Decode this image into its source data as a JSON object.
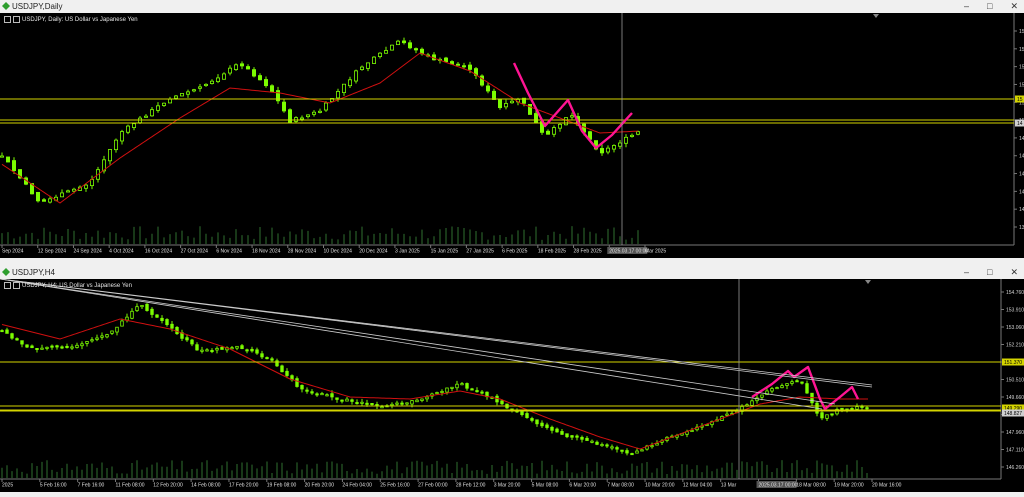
{
  "top": {
    "window_title": "USDJPY,Daily",
    "chart_label": "USDJPY, Daily: US Dollar vs Japanese Yen",
    "x_labels": [
      "Sep 2024",
      "12 Sep 2024",
      "24 Sep 2024",
      "4 Oct 2024",
      "16 Oct 2024",
      "27 Oct 2024",
      "6 Nov 2024",
      "18 Nov 2024",
      "28 Nov 2024",
      "10 Dec 2024",
      "20 Dec 2024",
      "3 Jan 2025",
      "15 Jan 2025",
      "27 Jan 2025",
      "6 Feb 2025",
      "18 Feb 2025",
      "28 Feb 2025",
      "2025.03.17 00:00",
      "Mar 2025"
    ],
    "y_labels": [
      "15",
      "15",
      "15",
      "15",
      "15",
      "15",
      "14",
      "14",
      "14",
      "14",
      "14",
      "13"
    ],
    "price_tag": "15",
    "price_tag2": "14"
  },
  "bottom": {
    "window_title": "USDJPY,H4",
    "chart_label": "USDJPY, H4: US Dollar vs Japanese Yen",
    "x_labels": [
      "2025",
      "5 Feb 16:00",
      "7 Feb 16:00",
      "11 Feb 08:00",
      "12 Feb 20:00",
      "14 Feb 08:00",
      "17 Feb 20:00",
      "19 Feb 08:00",
      "20 Feb 20:00",
      "24 Feb 04:00",
      "25 Feb 16:00",
      "27 Feb 00:00",
      "28 Feb 12:00",
      "3 Mar 20:00",
      "5 Mar 08:00",
      "6 Mar 20:00",
      "7 Mar 08:00",
      "10 Mar 20:00",
      "12 Mar 04:00",
      "13 Mar",
      "2025.03.17 00:00",
      "18 Mar 08:00",
      "19 Mar 20:00",
      "20 Mar 16:00"
    ],
    "y_labels": [
      "154.760",
      "153.910",
      "153.060",
      "152.210",
      "151.360",
      "150.510",
      "149.660",
      "148.810",
      "147.960",
      "147.110",
      "146.260"
    ],
    "price_tag": "151.370",
    "price_tag2": "149.290",
    "price_tag3": "148.827"
  },
  "colors": {
    "candle": "#7CFC00",
    "ma": "#d01010",
    "level": "#d4d400",
    "pattern": "#ff1493",
    "axis_text": "#d0d0d0"
  }
}
